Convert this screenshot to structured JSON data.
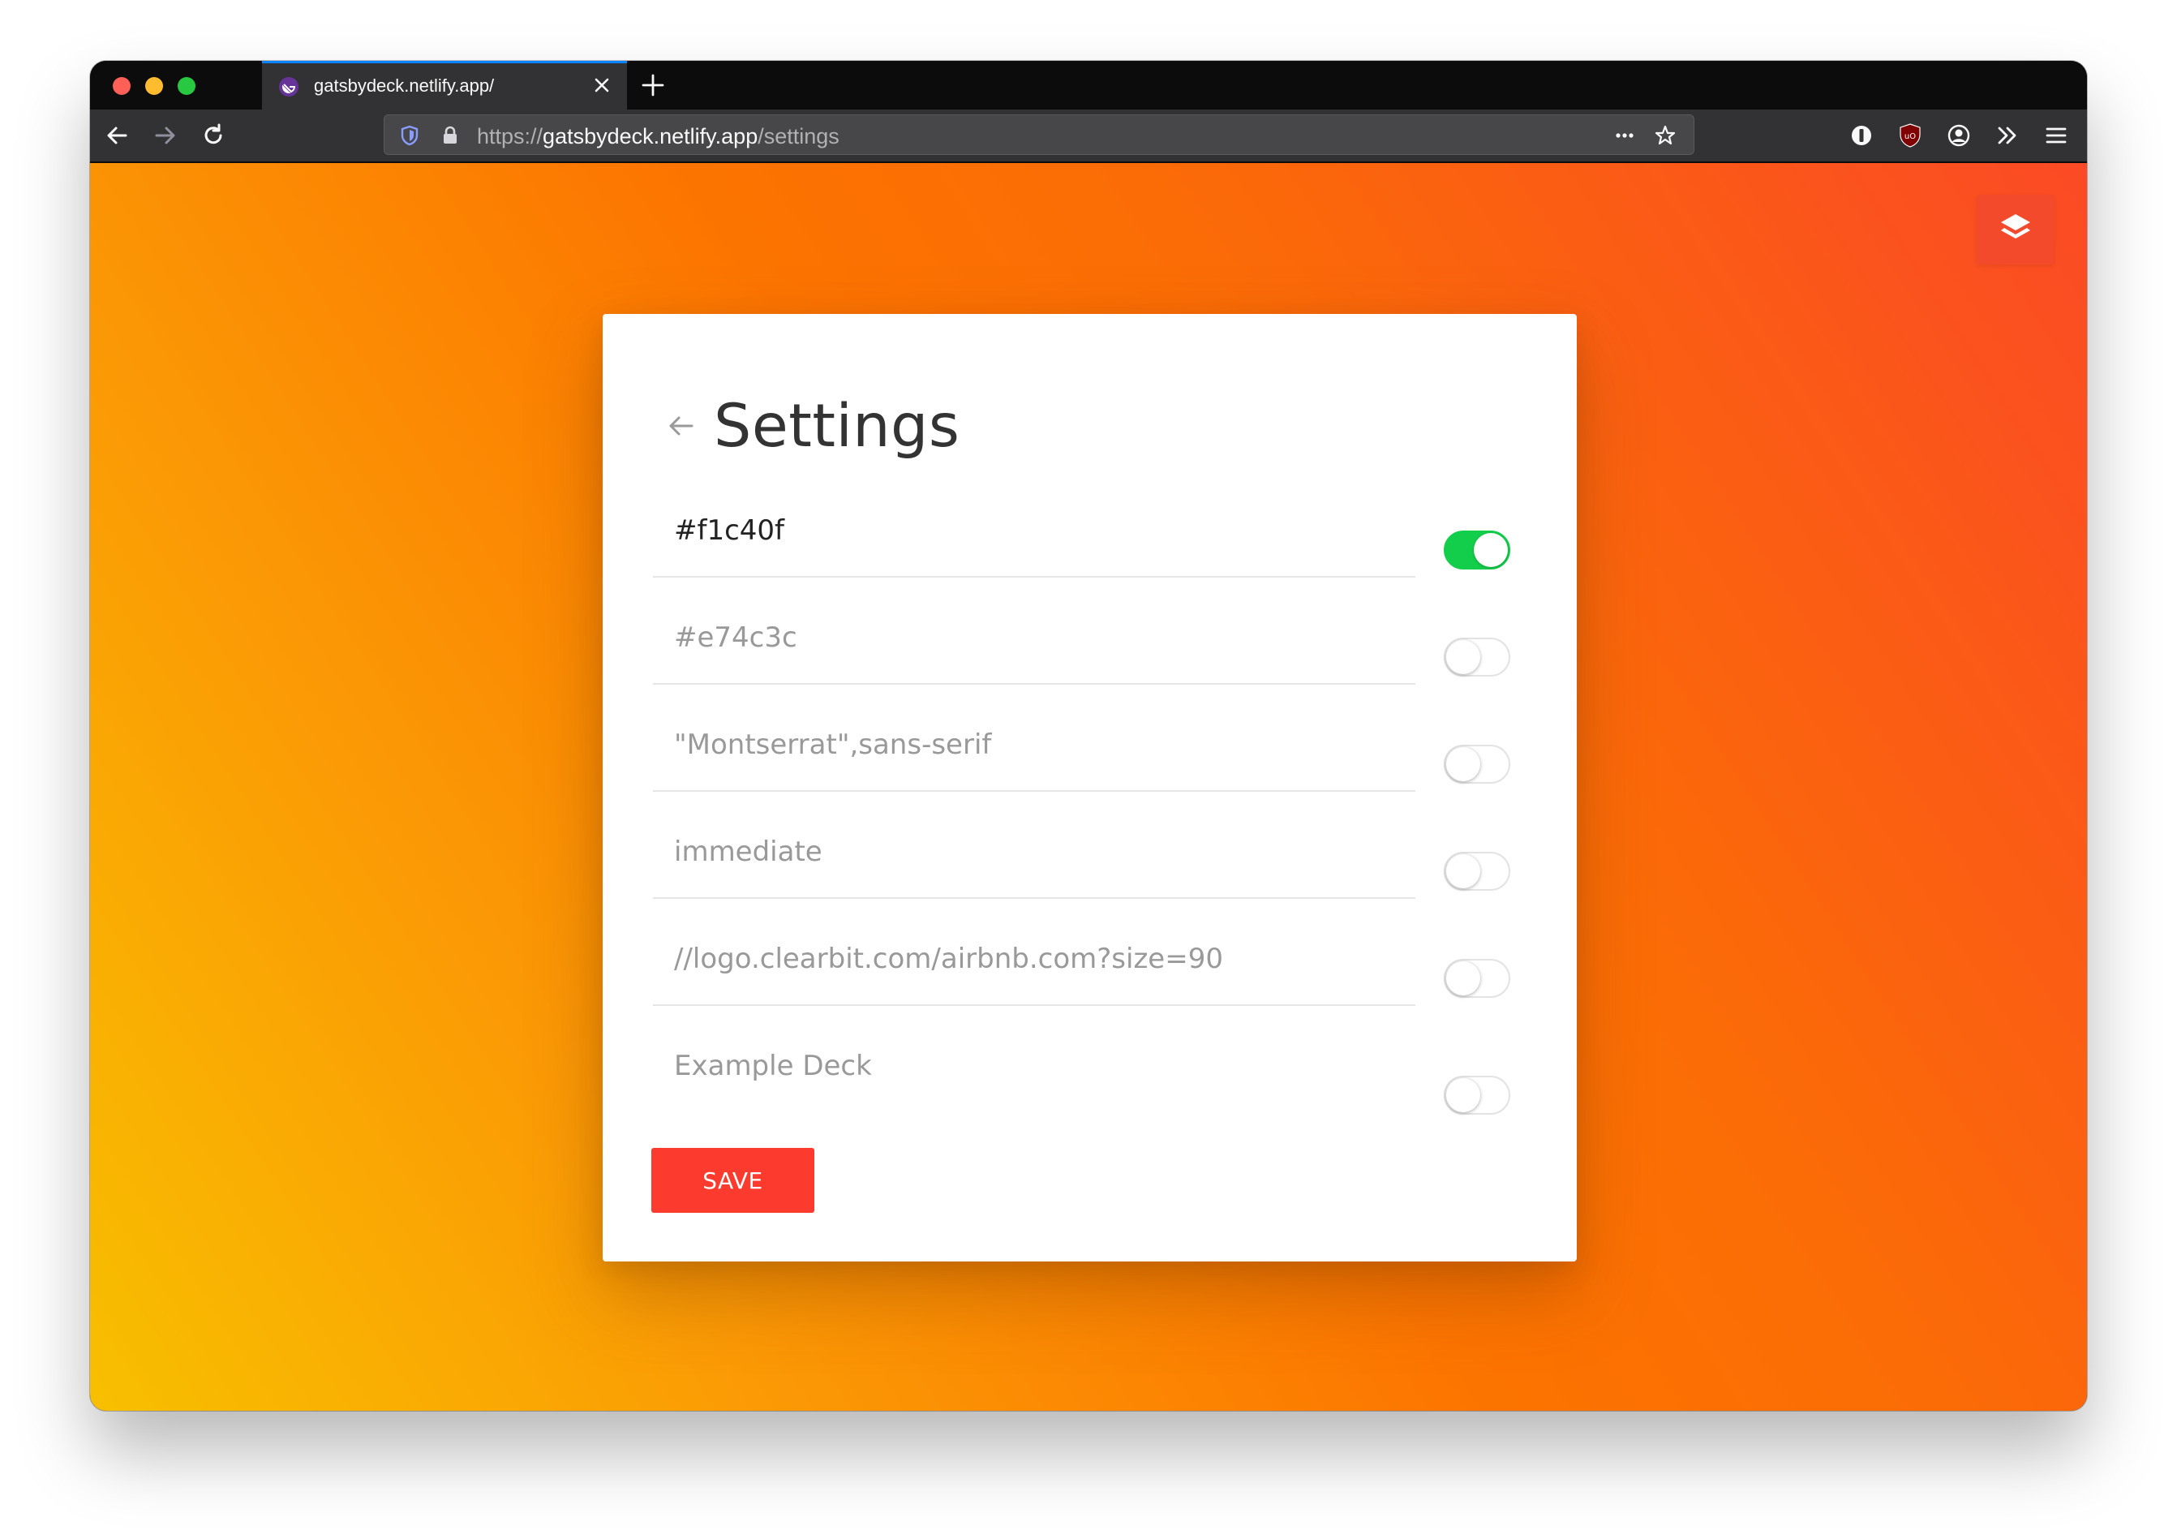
{
  "browser": {
    "tab_title": "gatsbydeck.netlify.app/",
    "url_scheme": "https://",
    "url_host": "gatsbydeck.netlify.app",
    "url_path": "/settings"
  },
  "settings": {
    "title": "Settings",
    "fields": [
      {
        "value": "#f1c40f",
        "enabled": true
      },
      {
        "value": "#e74c3c",
        "enabled": false
      },
      {
        "value": "\"Montserrat\",sans-serif",
        "enabled": false
      },
      {
        "value": "immediate",
        "enabled": false
      },
      {
        "value": "//logo.clearbit.com/airbnb.com?size=90",
        "enabled": false
      },
      {
        "value": "Example Deck",
        "enabled": false
      }
    ],
    "save_label": "SAVE"
  },
  "colors": {
    "save_button": "#fc3a2e",
    "toggle_on": "#13ce4a",
    "gradient": [
      "#f8bf00",
      "#fc7400",
      "#fb4a25"
    ]
  },
  "icons": [
    "layers-icon",
    "back-arrow-icon",
    "shield-icon",
    "lock-icon",
    "star-icon",
    "more-icon"
  ]
}
